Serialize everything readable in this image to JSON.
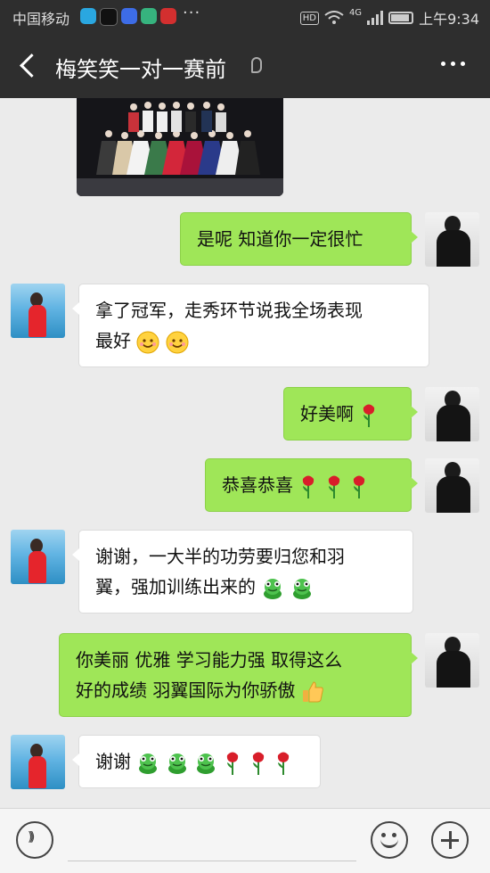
{
  "status_bar": {
    "carrier": "中国移动",
    "app_icons": [
      "telegram-app-icon",
      "tiktok-app-icon",
      "baidu-app-icon",
      "location-app-icon",
      "huawei-app-icon"
    ],
    "more": "···",
    "hd": "HD",
    "network": "4G",
    "time": "上午9:34"
  },
  "header": {
    "back_icon": "chevron-left-icon",
    "title": "梅笑笑一对一赛前",
    "ear_icon": "ear-icon",
    "more_icon": "more-dots-icon"
  },
  "messages": [
    {
      "from": "me",
      "text": "是呢 知道你一定很忙",
      "emojis": []
    },
    {
      "from": "her",
      "text": "拿了冠军，走秀环节说我全场表现\n最好",
      "emojis": [
        "smile",
        "smile"
      ]
    },
    {
      "from": "me",
      "text": "好美啊",
      "emojis": [
        "rose"
      ]
    },
    {
      "from": "me",
      "text": "恭喜恭喜",
      "emojis": [
        "rose",
        "rose",
        "rose"
      ]
    },
    {
      "from": "her",
      "text": "谢谢，一大半的功劳要归您和羽\n翼，强加训练出来的",
      "emojis": [
        "frog",
        "frog"
      ]
    },
    {
      "from": "me",
      "text": "你美丽 优雅 学习能力强 取得这么\n好的成绩 羽翼国际为你骄傲",
      "emojis": [
        "thumbs-up"
      ]
    },
    {
      "from": "her",
      "text": "谢谢",
      "emojis": [
        "frog",
        "frog",
        "frog",
        "rose",
        "rose",
        "rose"
      ]
    }
  ],
  "input_bar": {
    "voice_icon": "voice-icon",
    "placeholder": "",
    "emoji_icon": "emoji-icon",
    "plus_icon": "plus-icon"
  },
  "colors": {
    "bar": "#2e2e2e",
    "background": "#ebebeb",
    "bubble_me": "#9fe658",
    "bubble_her": "#ffffff"
  }
}
